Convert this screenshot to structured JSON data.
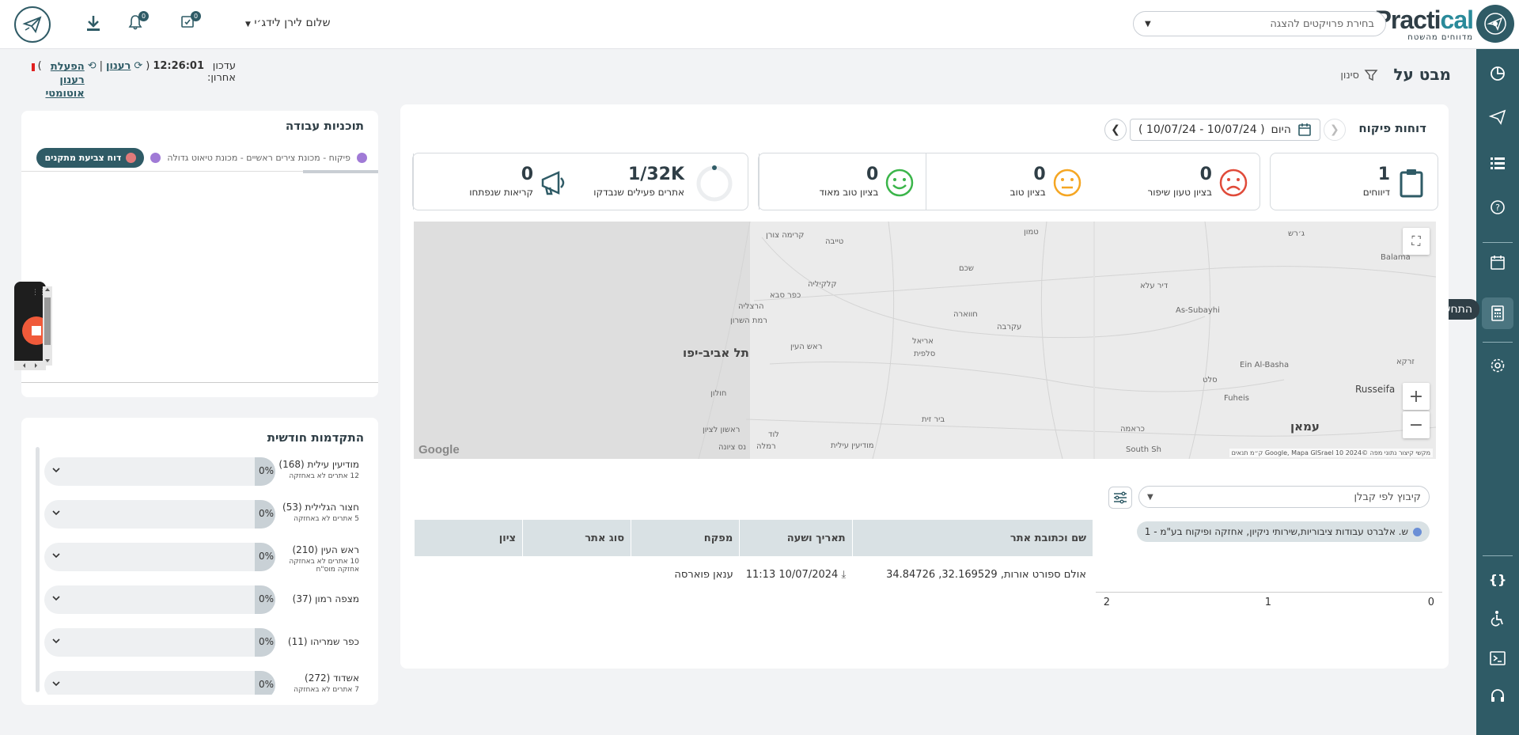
{
  "header": {
    "logo_main": "Practi",
    "logo_accent": "cal",
    "logo_sub": "מדווחים מהשטח",
    "project_placeholder": "בחירת פרויקטים להצגה",
    "greeting": "שלום לירן לידג׳י",
    "notifications_count": "0",
    "tasks_count": "0"
  },
  "nav": {
    "tooltip": "התחשבנות"
  },
  "subheader": {
    "title": "מבט על",
    "filter_label": "סינון",
    "update_label": "עדכון",
    "update_label2": "אחרון:",
    "update_time": "12:26:01",
    "refresh": "רענון",
    "auto_refresh": "הפעלת רענון אוטומטי"
  },
  "inspection": {
    "title": "דוחות פיקוח",
    "today": "היום",
    "date_range": "( 10/07/24 - 10/07/24 )",
    "kpis": [
      {
        "value": "1",
        "label": "דיווחים"
      },
      {
        "value": "0",
        "label": "בציון טוב מאוד"
      },
      {
        "value": "0",
        "label": "בציון טוב"
      },
      {
        "value": "0",
        "label": "בציון טעון שיפור"
      },
      {
        "value": "0",
        "label": "קריאות שנפתחו"
      },
      {
        "value": "1/32K",
        "label": "אתרים פעילים שנבדקו"
      }
    ],
    "colors": {
      "good_very": "#3bb54a",
      "good": "#f5a623",
      "bad": "#e04b3a",
      "primary": "#2f5b66"
    }
  },
  "map": {
    "labels": [
      {
        "text": "תל אביב-יפו",
        "big": true
      },
      {
        "text": "חולון"
      },
      {
        "text": "ראשון לציון"
      },
      {
        "text": "הרצליה"
      },
      {
        "text": "רמת השרון"
      },
      {
        "text": "כפר סבא"
      },
      {
        "text": "קלקיליה"
      },
      {
        "text": "ראש העין"
      },
      {
        "text": "אריאל"
      },
      {
        "text": "סלפית"
      },
      {
        "text": "שכם"
      },
      {
        "text": "חווארה"
      },
      {
        "text": "עקרבה"
      },
      {
        "text": "קרימה צורן"
      },
      {
        "text": "טייבה"
      },
      {
        "text": "טמון"
      },
      {
        "text": "ג׳רש"
      },
      {
        "text": "Balama"
      },
      {
        "text": "As-Subayhi"
      },
      {
        "text": "Ein Al-Basha"
      },
      {
        "text": "Russeifa"
      },
      {
        "text": "Fuheis"
      },
      {
        "text": "עמאן",
        "big": true
      },
      {
        "text": "זרקא"
      },
      {
        "text": "סלט"
      },
      {
        "text": "דיר עלא"
      },
      {
        "text": "ביר זית"
      },
      {
        "text": "מודיעין עילית"
      },
      {
        "text": "רמלה"
      },
      {
        "text": "לוד"
      },
      {
        "text": "נס ציונה"
      },
      {
        "text": "כראמה"
      },
      {
        "text": "South Sh"
      }
    ],
    "google": "Google",
    "attribution": "מקשי קיצור  נתוני מפה ©2024 Google, Mapa GISrael  10 ק״מ  תנאים"
  },
  "grouping": {
    "label": "קיבוץ לפי קבלן",
    "legend": "ש. אלברט עבודות ציבוריות,שירותי ניקיון, אחזקה ופיקוח בע\"מ - 1",
    "axis": [
      "0",
      "1",
      "2"
    ]
  },
  "table": {
    "headers": [
      "שם וכתובת אתר",
      "תאריך ושעה",
      "מפקח",
      "סוג אתר",
      "ציון"
    ],
    "rows": [
      {
        "site": "אולם ספורט אורות, 32.169529, 34.84726",
        "datetime": "10/07/2024 11:13",
        "inspector": "ענאן פוארסה",
        "type": "",
        "score": ""
      }
    ]
  },
  "work_plans": {
    "title": "תוכניות עבודה",
    "active_tab": "דוח צביעת מתקנים",
    "tab2": "פיקוח - מכונת צירים ראשיים - מכונת טיאוט גדולה"
  },
  "monthly": {
    "title": "התקדמות חודשית",
    "rows": [
      {
        "name": "מודיעין עילית (168)",
        "sub": "12 אתרים לא באחזקה",
        "pct": "0%"
      },
      {
        "name": "חצור הגלילית (53)",
        "sub": "5 אתרים לא באחזקה",
        "pct": "0%"
      },
      {
        "name": "ראש העין (210)",
        "sub": "10 אתרים לא באחזקה אחזקה מוס\"ח",
        "pct": "0%"
      },
      {
        "name": "מצפה רמון (37)",
        "sub": "",
        "pct": "0%"
      },
      {
        "name": "כפר שמריהו (11)",
        "sub": "",
        "pct": "0%"
      },
      {
        "name": "אשדוד (272)",
        "sub": "7 אתרים לא באחזקה",
        "pct": "0%"
      }
    ]
  }
}
